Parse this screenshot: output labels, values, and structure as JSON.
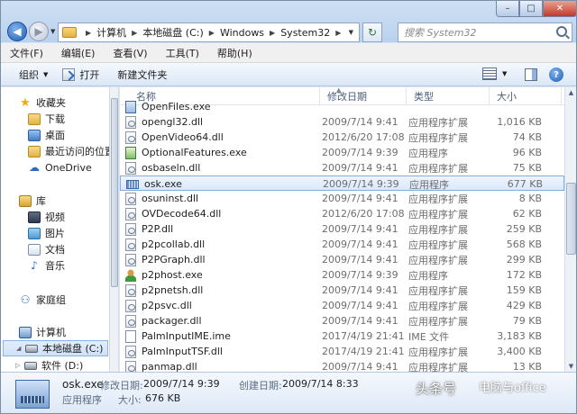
{
  "window": {
    "controls": {
      "minimize": "–",
      "maximize": "□",
      "close": "✕"
    }
  },
  "address": {
    "crumbs": [
      "计算机",
      "本地磁盘 (C:)",
      "Windows",
      "System32"
    ]
  },
  "search": {
    "placeholder": "搜索 System32"
  },
  "menu": [
    "文件(F)",
    "编辑(E)",
    "查看(V)",
    "工具(T)",
    "帮助(H)"
  ],
  "toolbar": {
    "organize": "组织",
    "open": "打开",
    "new_folder": "新建文件夹"
  },
  "sidebar": {
    "favorites": "收藏夹",
    "downloads": "下载",
    "desktop": "桌面",
    "recent": "最近访问的位置",
    "onedrive": "OneDrive",
    "library": "库",
    "videos": "视频",
    "pictures": "图片",
    "documents": "文档",
    "music": "音乐",
    "homegroup": "家庭组",
    "computer": "计算机",
    "local_disk": "本地磁盘 (C:)",
    "soft_disk": "软件 (D:)"
  },
  "columns": {
    "name": "名称",
    "date": "修改日期",
    "type": "类型",
    "size": "大小"
  },
  "files": [
    {
      "name": "OpenFiles.exe",
      "date": "",
      "type": "",
      "size": "",
      "icon": "exe"
    },
    {
      "name": "opengl32.dll",
      "date": "2009/7/14 9:41",
      "type": "应用程序扩展",
      "size": "1,016 KB",
      "icon": "dll"
    },
    {
      "name": "OpenVideo64.dll",
      "date": "2012/6/20 17:08",
      "type": "应用程序扩展",
      "size": "74 KB",
      "icon": "dll"
    },
    {
      "name": "OptionalFeatures.exe",
      "date": "2009/7/14 9:39",
      "type": "应用程序",
      "size": "96 KB",
      "icon": "features"
    },
    {
      "name": "osbaseln.dll",
      "date": "2009/7/14 9:41",
      "type": "应用程序扩展",
      "size": "75 KB",
      "icon": "dll"
    },
    {
      "name": "osk.exe",
      "date": "2009/7/14 9:39",
      "type": "应用程序",
      "size": "677 KB",
      "icon": "kbd"
    },
    {
      "name": "osuninst.dll",
      "date": "2009/7/14 9:41",
      "type": "应用程序扩展",
      "size": "8 KB",
      "icon": "dll"
    },
    {
      "name": "OVDecode64.dll",
      "date": "2012/6/20 17:08",
      "type": "应用程序扩展",
      "size": "62 KB",
      "icon": "dll"
    },
    {
      "name": "P2P.dll",
      "date": "2009/7/14 9:41",
      "type": "应用程序扩展",
      "size": "259 KB",
      "icon": "dll"
    },
    {
      "name": "p2pcollab.dll",
      "date": "2009/7/14 9:41",
      "type": "应用程序扩展",
      "size": "568 KB",
      "icon": "dll"
    },
    {
      "name": "P2PGraph.dll",
      "date": "2009/7/14 9:41",
      "type": "应用程序扩展",
      "size": "299 KB",
      "icon": "dll"
    },
    {
      "name": "p2phost.exe",
      "date": "2009/7/14 9:39",
      "type": "应用程序",
      "size": "172 KB",
      "icon": "person"
    },
    {
      "name": "p2pnetsh.dll",
      "date": "2009/7/14 9:41",
      "type": "应用程序扩展",
      "size": "159 KB",
      "icon": "dll"
    },
    {
      "name": "p2psvc.dll",
      "date": "2009/7/14 9:41",
      "type": "应用程序扩展",
      "size": "429 KB",
      "icon": "dll"
    },
    {
      "name": "packager.dll",
      "date": "2009/7/14 9:41",
      "type": "应用程序扩展",
      "size": "79 KB",
      "icon": "dll"
    },
    {
      "name": "PalmInputIME.ime",
      "date": "2017/4/19 21:41",
      "type": "IME 文件",
      "size": "3,183 KB",
      "icon": "ime"
    },
    {
      "name": "PalmInputTSF.dll",
      "date": "2017/4/19 21:41",
      "type": "应用程序扩展",
      "size": "3,400 KB",
      "icon": "dll"
    },
    {
      "name": "panmap.dll",
      "date": "2009/7/14 9:41",
      "type": "应用程序扩展",
      "size": "13 KB",
      "icon": "dll"
    }
  ],
  "selected_index": 5,
  "details": {
    "name": "osk.exe",
    "modified_label": "修改日期:",
    "modified_value": "2009/7/14 9:39",
    "created_label": "创建日期:",
    "created_value": "2009/7/14 8:33",
    "type": "应用程序",
    "size_label": "大小:",
    "size_value": "676 KB"
  },
  "watermark": {
    "left": "头条号",
    "right": "电脑与office"
  }
}
